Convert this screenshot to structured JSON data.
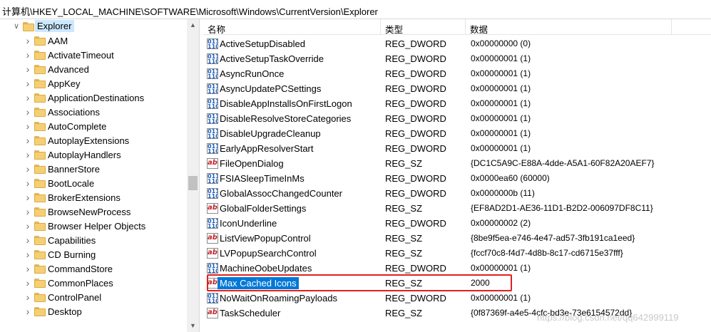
{
  "address": "计算机\\HKEY_LOCAL_MACHINE\\SOFTWARE\\Microsoft\\Windows\\CurrentVersion\\Explorer",
  "tree": {
    "root": "Explorer",
    "children": [
      "AAM",
      "ActivateTimeout",
      "Advanced",
      "AppKey",
      "ApplicationDestinations",
      "Associations",
      "AutoComplete",
      "AutoplayExtensions",
      "AutoplayHandlers",
      "BannerStore",
      "BootLocale",
      "BrokerExtensions",
      "BrowseNewProcess",
      "Browser Helper Objects",
      "Capabilities",
      "CD Burning",
      "CommandStore",
      "CommonPlaces",
      "ControlPanel",
      "Desktop"
    ]
  },
  "columns": {
    "name": "名称",
    "type": "类型",
    "data": "数据"
  },
  "values": [
    {
      "name": "ActiveSetupDisabled",
      "type": "REG_DWORD",
      "data": "0x00000000 (0)",
      "icon": "dword"
    },
    {
      "name": "ActiveSetupTaskOverride",
      "type": "REG_DWORD",
      "data": "0x00000001 (1)",
      "icon": "dword"
    },
    {
      "name": "AsyncRunOnce",
      "type": "REG_DWORD",
      "data": "0x00000001 (1)",
      "icon": "dword"
    },
    {
      "name": "AsyncUpdatePCSettings",
      "type": "REG_DWORD",
      "data": "0x00000001 (1)",
      "icon": "dword"
    },
    {
      "name": "DisableAppInstallsOnFirstLogon",
      "type": "REG_DWORD",
      "data": "0x00000001 (1)",
      "icon": "dword"
    },
    {
      "name": "DisableResolveStoreCategories",
      "type": "REG_DWORD",
      "data": "0x00000001 (1)",
      "icon": "dword"
    },
    {
      "name": "DisableUpgradeCleanup",
      "type": "REG_DWORD",
      "data": "0x00000001 (1)",
      "icon": "dword"
    },
    {
      "name": "EarlyAppResolverStart",
      "type": "REG_DWORD",
      "data": "0x00000001 (1)",
      "icon": "dword"
    },
    {
      "name": "FileOpenDialog",
      "type": "REG_SZ",
      "data": "{DC1C5A9C-E88A-4dde-A5A1-60F82A20AEF7}",
      "icon": "sz"
    },
    {
      "name": "FSIASleepTimeInMs",
      "type": "REG_DWORD",
      "data": "0x0000ea60 (60000)",
      "icon": "dword"
    },
    {
      "name": "GlobalAssocChangedCounter",
      "type": "REG_DWORD",
      "data": "0x0000000b (11)",
      "icon": "dword"
    },
    {
      "name": "GlobalFolderSettings",
      "type": "REG_SZ",
      "data": "{EF8AD2D1-AE36-11D1-B2D2-006097DF8C11}",
      "icon": "sz"
    },
    {
      "name": "IconUnderline",
      "type": "REG_DWORD",
      "data": "0x00000002 (2)",
      "icon": "dword"
    },
    {
      "name": "ListViewPopupControl",
      "type": "REG_SZ",
      "data": "{8be9f5ea-e746-4e47-ad57-3fb191ca1eed}",
      "icon": "sz"
    },
    {
      "name": "LVPopupSearchControl",
      "type": "REG_SZ",
      "data": "{fccf70c8-f4d7-4d8b-8c17-cd6715e37fff}",
      "icon": "sz"
    },
    {
      "name": "MachineOobeUpdates",
      "type": "REG_DWORD",
      "data": "0x00000001 (1)",
      "icon": "dword"
    },
    {
      "name": "Max Cached Icons",
      "type": "REG_SZ",
      "data": "2000",
      "icon": "sz",
      "selected": true
    },
    {
      "name": "NoWaitOnRoamingPayloads",
      "type": "REG_DWORD",
      "data": "0x00000001 (1)",
      "icon": "dword"
    },
    {
      "name": "TaskScheduler",
      "type": "REG_SZ",
      "data": "{0f87369f-a4e5-4cfc-bd3e-73e6154572dd}",
      "icon": "sz"
    }
  ],
  "watermark": "https://blog.csdn.net/qq642999119"
}
